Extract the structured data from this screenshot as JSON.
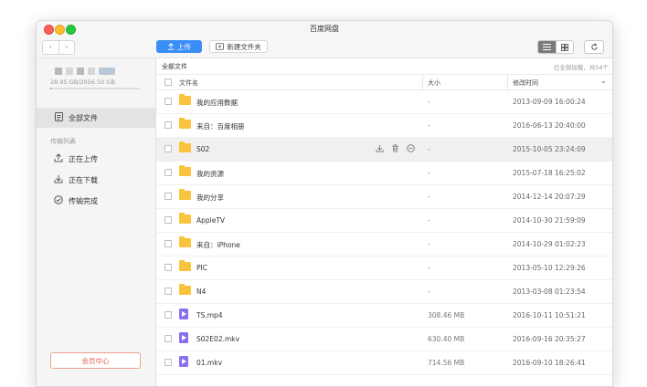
{
  "window": {
    "title": "百度网盘"
  },
  "toolbar": {
    "back_icon": "‹",
    "forward_icon": "›",
    "upload_label": "上传",
    "new_folder_label": "新建文件夹"
  },
  "sidebar": {
    "quota": "28.95 GB/2056.50 GB",
    "quota_used_fraction": 0.014,
    "all_files": "全部文件",
    "transfer_section": "传输列表",
    "uploading": "正在上传",
    "downloading": "正在下载",
    "completed": "传输完成",
    "vip_center": "会员中心"
  },
  "main": {
    "breadcrumb": "全部文件",
    "loaded_status": "已全部加载，共54个",
    "columns": {
      "name": "文件名",
      "size": "大小",
      "modified": "修改时间"
    },
    "files": [
      {
        "name": "我的应用数据",
        "size": "-",
        "modified": "2013-09-09 16:00:24",
        "type": "folder"
      },
      {
        "name": "来自：百度相册",
        "size": "-",
        "modified": "2016-06-13 20:40:00",
        "type": "folder"
      },
      {
        "name": "S02",
        "size": "-",
        "modified": "2015-10-05 23:24:09",
        "type": "folder"
      },
      {
        "name": "我的资源",
        "size": "-",
        "modified": "2015-07-18 16:25:02",
        "type": "folder"
      },
      {
        "name": "我的分享",
        "size": "-",
        "modified": "2014-12-14 20:07:29",
        "type": "folder"
      },
      {
        "name": "AppleTV",
        "size": "-",
        "modified": "2014-10-30 21:59:09",
        "type": "folder"
      },
      {
        "name": "来自：iPhone",
        "size": "-",
        "modified": "2014-10-29 01:02:23",
        "type": "folder"
      },
      {
        "name": "PIC",
        "size": "-",
        "modified": "2013-05-10 12:29:26",
        "type": "folder"
      },
      {
        "name": "N4",
        "size": "-",
        "modified": "2013-03-08 01:23:54",
        "type": "folder"
      },
      {
        "name": "TS.mp4",
        "size": "308.46 MB",
        "modified": "2016-10-11 10:51:21",
        "type": "video"
      },
      {
        "name": "S02E02.mkv",
        "size": "630.40 MB",
        "modified": "2016-09-16 20:35:27",
        "type": "video"
      },
      {
        "name": "01.mkv",
        "size": "714.56 MB",
        "modified": "2016-09-10 18:26:41",
        "type": "video"
      }
    ]
  },
  "colors": {
    "accent": "#3a8ef6",
    "folder": "#f9c43c",
    "video": "#8b6ef0",
    "vip": "#e8624c"
  }
}
